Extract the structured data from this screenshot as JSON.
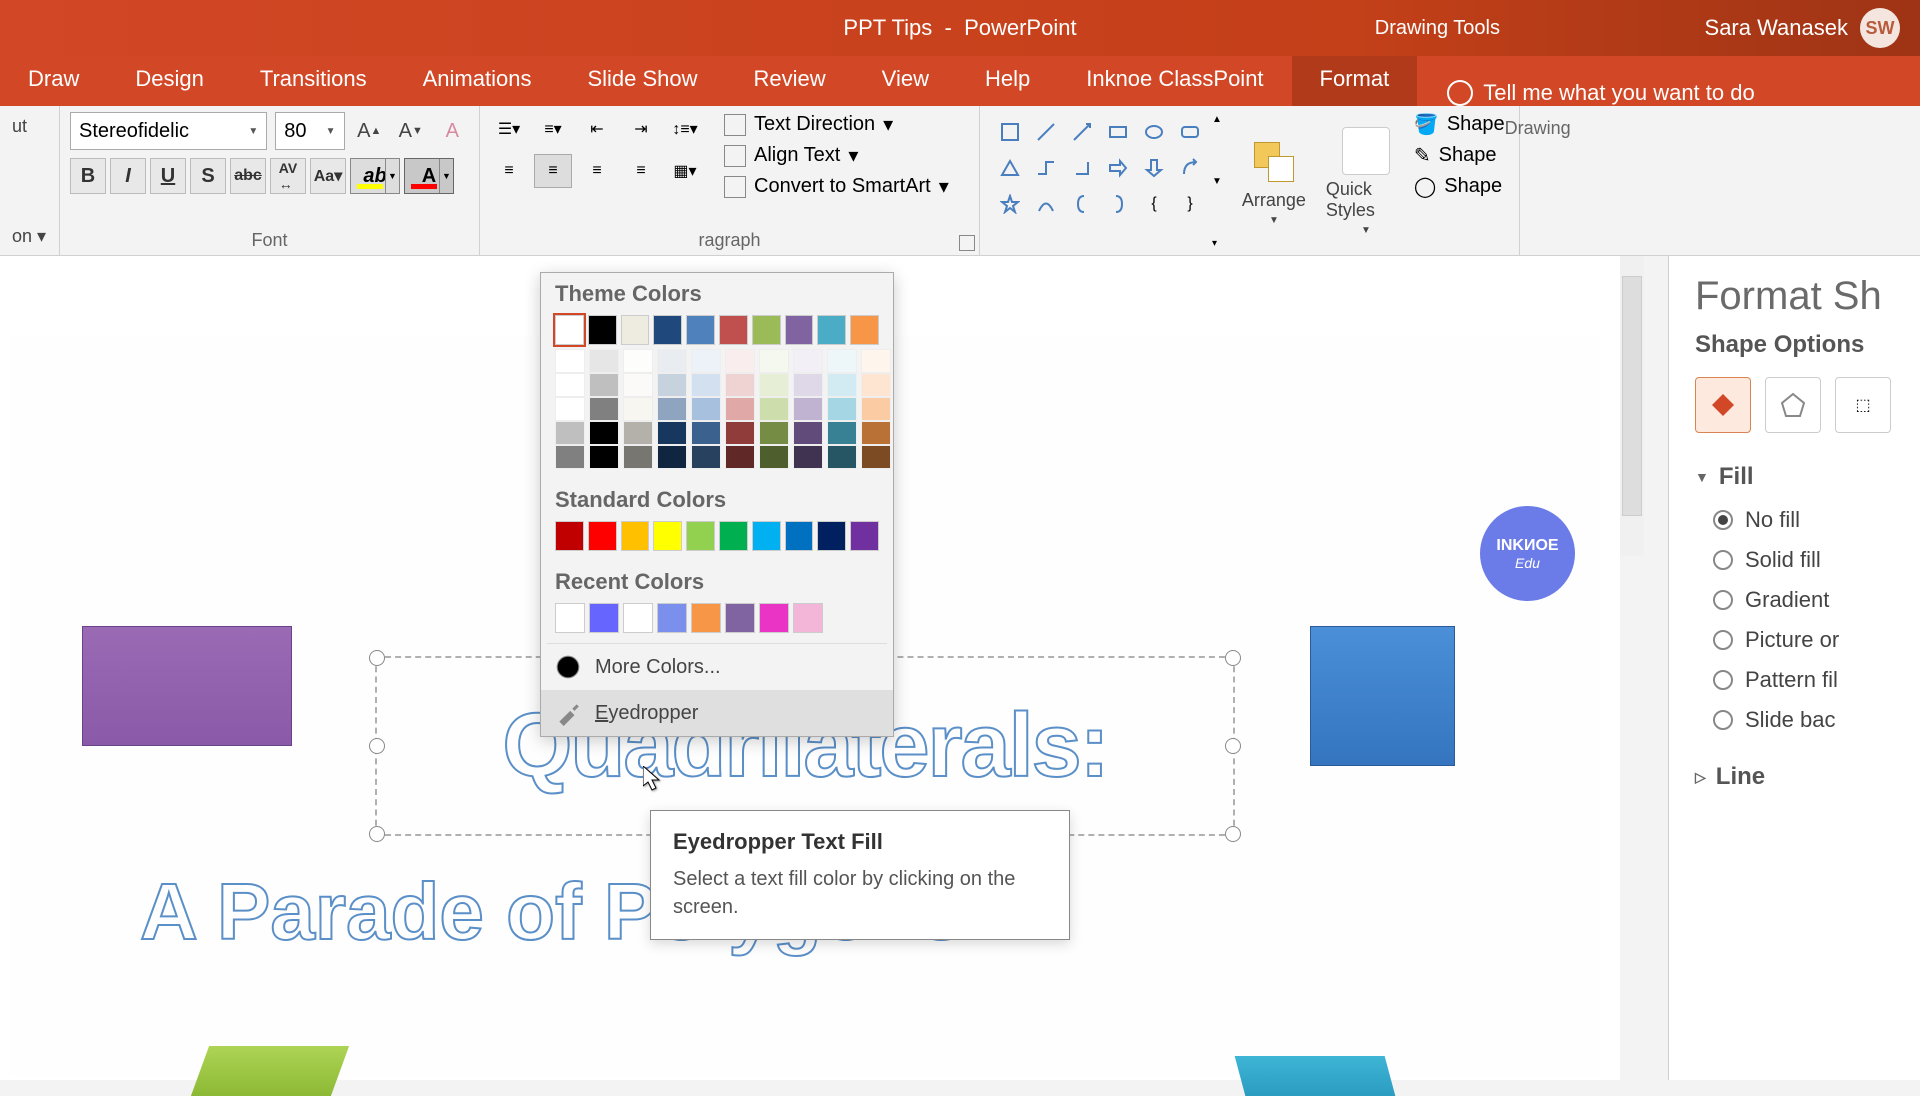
{
  "titlebar": {
    "doc_title": "PPT Tips",
    "app_name": "PowerPoint",
    "context_tab": "Drawing Tools",
    "user_name": "Sara Wanasek",
    "user_initials": "SW"
  },
  "tabs": {
    "draw": "Draw",
    "design": "Design",
    "transitions": "Transitions",
    "animations": "Animations",
    "slideshow": "Slide Show",
    "review": "Review",
    "view": "View",
    "help": "Help",
    "classpoint": "Inknoe ClassPoint",
    "format": "Format",
    "tellme": "Tell me what you want to do"
  },
  "ribbon": {
    "clip_cut": "ut",
    "clip_paste": "on",
    "font_name": "Stereofidelic",
    "font_size": "80",
    "font_group": "Font",
    "para_group": "ragraph",
    "text_direction": "Text Direction",
    "align_text": "Align Text",
    "convert_smartart": "Convert to SmartArt",
    "arrange": "Arrange",
    "quick_styles": "Quick Styles",
    "drawing_group": "Drawing",
    "shape_fill": "Shape",
    "shape_outline": "Shape",
    "shape_effects": "Shape"
  },
  "color_picker": {
    "theme_header": "Theme Colors",
    "standard_header": "Standard Colors",
    "recent_header": "Recent Colors",
    "more_colors": "More Colors...",
    "eyedropper": "Eyedropper",
    "theme_row": [
      "#ffffff",
      "#000000",
      "#eeece1",
      "#1f497d",
      "#4f81bd",
      "#c0504d",
      "#9bbb59",
      "#8064a2",
      "#4bacc6",
      "#f79646"
    ],
    "standard_row": [
      "#c00000",
      "#ff0000",
      "#ffc000",
      "#ffff00",
      "#92d050",
      "#00b050",
      "#00b0f0",
      "#0070c0",
      "#002060",
      "#7030a0"
    ],
    "recent_row": [
      "#ffffff",
      "#6666ff",
      "#ffffff",
      "#7b8fec",
      "#f79646",
      "#8064a2",
      "#e934c6",
      "#f4b6d8"
    ]
  },
  "tooltip": {
    "title": "Eyedropper Text Fill",
    "body": "Select a text fill color by clicking on the screen."
  },
  "slide": {
    "title_text": "Quadrilaterals:",
    "subtitle_text": "A Parade of               Polygons",
    "badge_line1": "INKИOE",
    "badge_line2": "Edu"
  },
  "right_panel": {
    "title": "Format Sh",
    "subtitle": "Shape Options",
    "fill_section": "Fill",
    "line_section": "Line",
    "no_fill": "No fill",
    "solid_fill": "Solid fill",
    "gradient_fill": "Gradient",
    "picture_fill": "Picture or",
    "pattern_fill": "Pattern fil",
    "slide_bg": "Slide bac"
  }
}
